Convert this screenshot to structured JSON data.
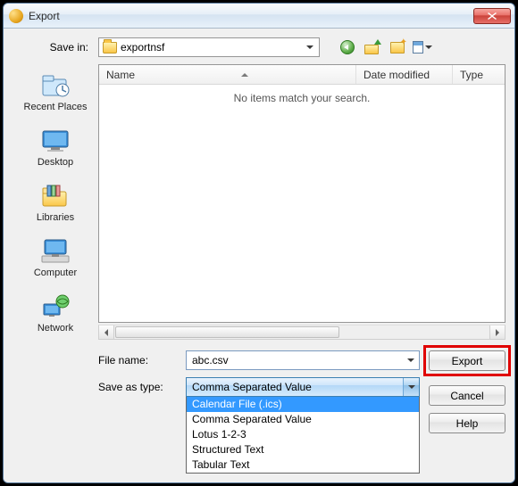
{
  "window": {
    "title": "Export"
  },
  "toolbar": {
    "save_in_label": "Save in:",
    "current_folder": "exportnsf"
  },
  "places": [
    {
      "label": "Recent Places"
    },
    {
      "label": "Desktop"
    },
    {
      "label": "Libraries"
    },
    {
      "label": "Computer"
    },
    {
      "label": "Network"
    }
  ],
  "listview": {
    "columns": {
      "name": "Name",
      "date": "Date modified",
      "type": "Type"
    },
    "empty_message": "No items match your search."
  },
  "form": {
    "filename_label": "File name:",
    "filename_value": "abc.csv",
    "savetype_label": "Save as type:",
    "savetype_selected": "Comma Separated Value",
    "savetype_options": [
      "Calendar File (.ics)",
      "Comma Separated Value",
      "Lotus 1-2-3",
      "Structured Text",
      "Tabular Text"
    ],
    "savetype_highlighted_index": 0
  },
  "buttons": {
    "export": "Export",
    "cancel": "Cancel",
    "help": "Help"
  }
}
